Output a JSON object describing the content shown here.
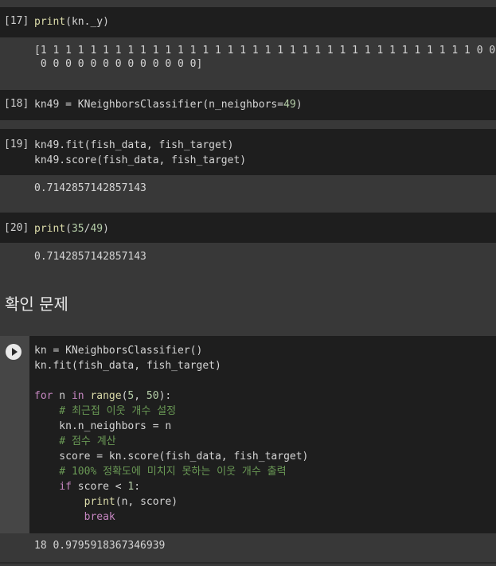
{
  "cells": [
    {
      "prompt": "[17]",
      "lines": [
        "print(kn._y)"
      ],
      "output": [
        "[1 1 1 1 1 1 1 1 1 1 1 1 1 1 1 1 1 1 1 1 1 1 1 1 1 1 1 1 1 1 1 1 1 1 1 0 0",
        " 0 0 0 0 0 0 0 0 0 0 0 0 0]"
      ]
    },
    {
      "prompt": "[18]",
      "lines": [
        "kn49 = KNeighborsClassifier(n_neighbors=49)"
      ],
      "output": []
    },
    {
      "prompt": "[19]",
      "lines": [
        "kn49.fit(fish_data, fish_target)",
        "kn49.score(fish_data, fish_target)"
      ],
      "output": [
        "0.7142857142857143"
      ]
    },
    {
      "prompt": "[20]",
      "lines": [
        "print(35/49)"
      ],
      "output": [
        "0.7142857142857143"
      ]
    }
  ],
  "section_heading": "확인 문제",
  "last_cell": {
    "lines": [
      "kn = KNeighborsClassifier()",
      "kn.fit(fish_data, fish_target)",
      "",
      "for n in range(5, 50):",
      "    # 최근접 이웃 개수 설정",
      "    kn.n_neighbors = n",
      "    # 점수 계산",
      "    score = kn.score(fish_data, fish_target)",
      "    # 100% 정확도에 미치지 못하는 이웃 개수 출력",
      "    if score < 1:",
      "        print(n, score)",
      "        break"
    ],
    "output": "18 0.9795918367346939"
  },
  "colors": {
    "keyword": "#c586c0",
    "builtin": "#dcdcaa",
    "comment": "#6a9955",
    "number": "#b5cea8"
  }
}
